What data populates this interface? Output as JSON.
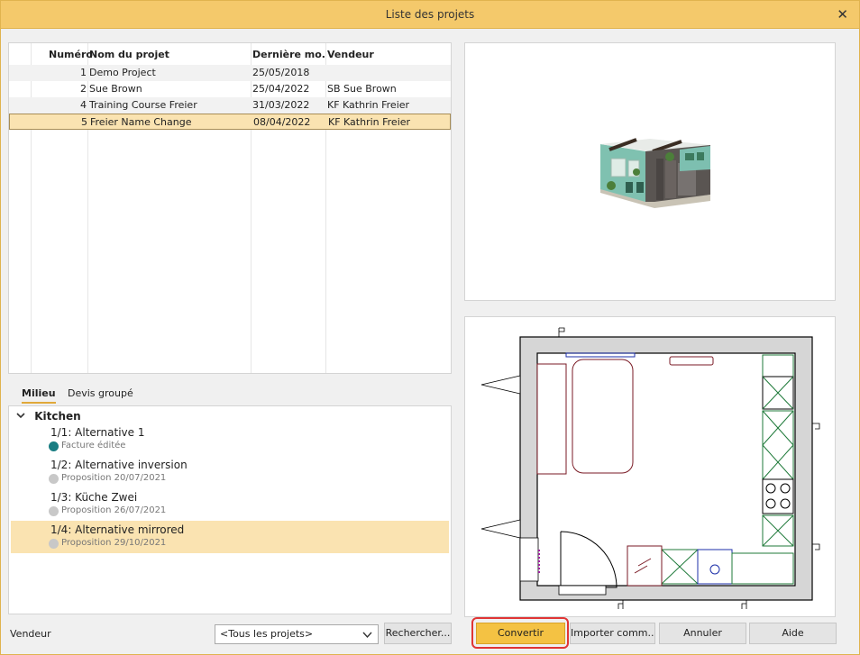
{
  "window": {
    "title": "Liste des projets",
    "close_glyph": "✕"
  },
  "projects": {
    "headers": {
      "num": "Numéro",
      "name": "Nom du projet",
      "date": "Dernière mo...",
      "vendor": "Vendeur"
    },
    "rows": [
      {
        "num": "1",
        "name": "Demo Project",
        "date": "25/05/2018",
        "vendor": ""
      },
      {
        "num": "2",
        "name": "Sue Brown",
        "date": "25/04/2022",
        "vendor": "SB Sue Brown"
      },
      {
        "num": "4",
        "name": "Training Course Freier",
        "date": "31/03/2022",
        "vendor": "KF Kathrin Freier"
      },
      {
        "num": "5",
        "name": "Freier Name Change",
        "date": "08/04/2022",
        "vendor": "KF Kathrin Freier"
      }
    ]
  },
  "tabs": [
    {
      "label": "Milieu"
    },
    {
      "label": "Devis groupé"
    }
  ],
  "alternatives": {
    "group": "Kitchen",
    "items": [
      {
        "title": "1/1: Alternative 1",
        "status": "Facture éditée",
        "color": "#197d82"
      },
      {
        "title": "1/2: Alternative inversion",
        "status": "Proposition 20/07/2021",
        "color": "#c8c8c8"
      },
      {
        "title": "1/3: Küche Zwei",
        "status": "Proposition 26/07/2021",
        "color": "#c8c8c8"
      },
      {
        "title": "1/4: Alternative mirrored",
        "status": "Proposition 29/10/2021",
        "color": "#c8c8c8"
      }
    ]
  },
  "bottom": {
    "vendeur_label": "Vendeur",
    "select_value": "<Tous les projets>",
    "search_btn": "Rechercher...",
    "convert_btn": "Convertir",
    "import_btn": "Importer comm...",
    "cancel_btn": "Annuler",
    "help_btn": "Aide"
  },
  "colors": {
    "accent": "#f4c96b",
    "selection": "#fae3b1",
    "highlight_outline": "#e03535"
  }
}
